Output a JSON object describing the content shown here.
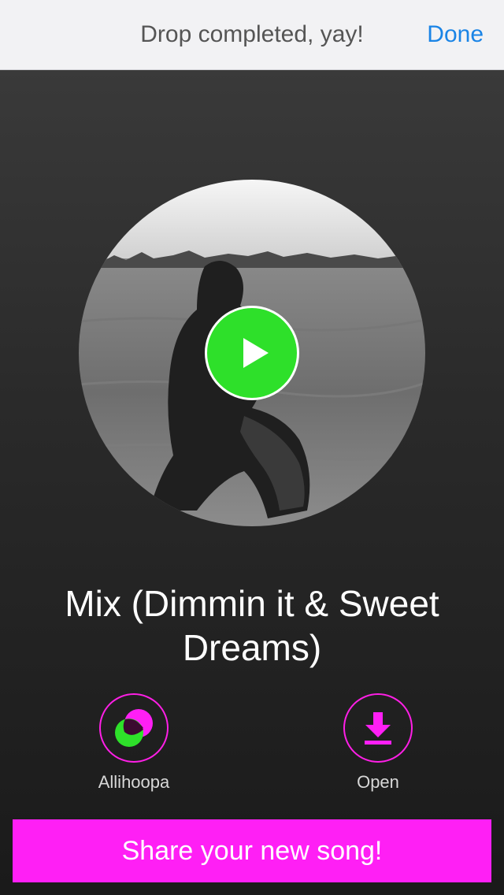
{
  "header": {
    "title": "Drop completed, yay!",
    "done_label": "Done"
  },
  "cover": {
    "icon": "album-cover-image"
  },
  "player": {
    "play_icon": "play-icon"
  },
  "song": {
    "title": "Mix (Dimmin it & Sweet Dreams)"
  },
  "actions": {
    "allihoopa_label": "Allihoopa",
    "open_label": "Open"
  },
  "share": {
    "label": "Share your new song!"
  },
  "colors": {
    "accent": "#ff1ff5",
    "play": "#2ee02a",
    "link": "#1a84e6"
  }
}
